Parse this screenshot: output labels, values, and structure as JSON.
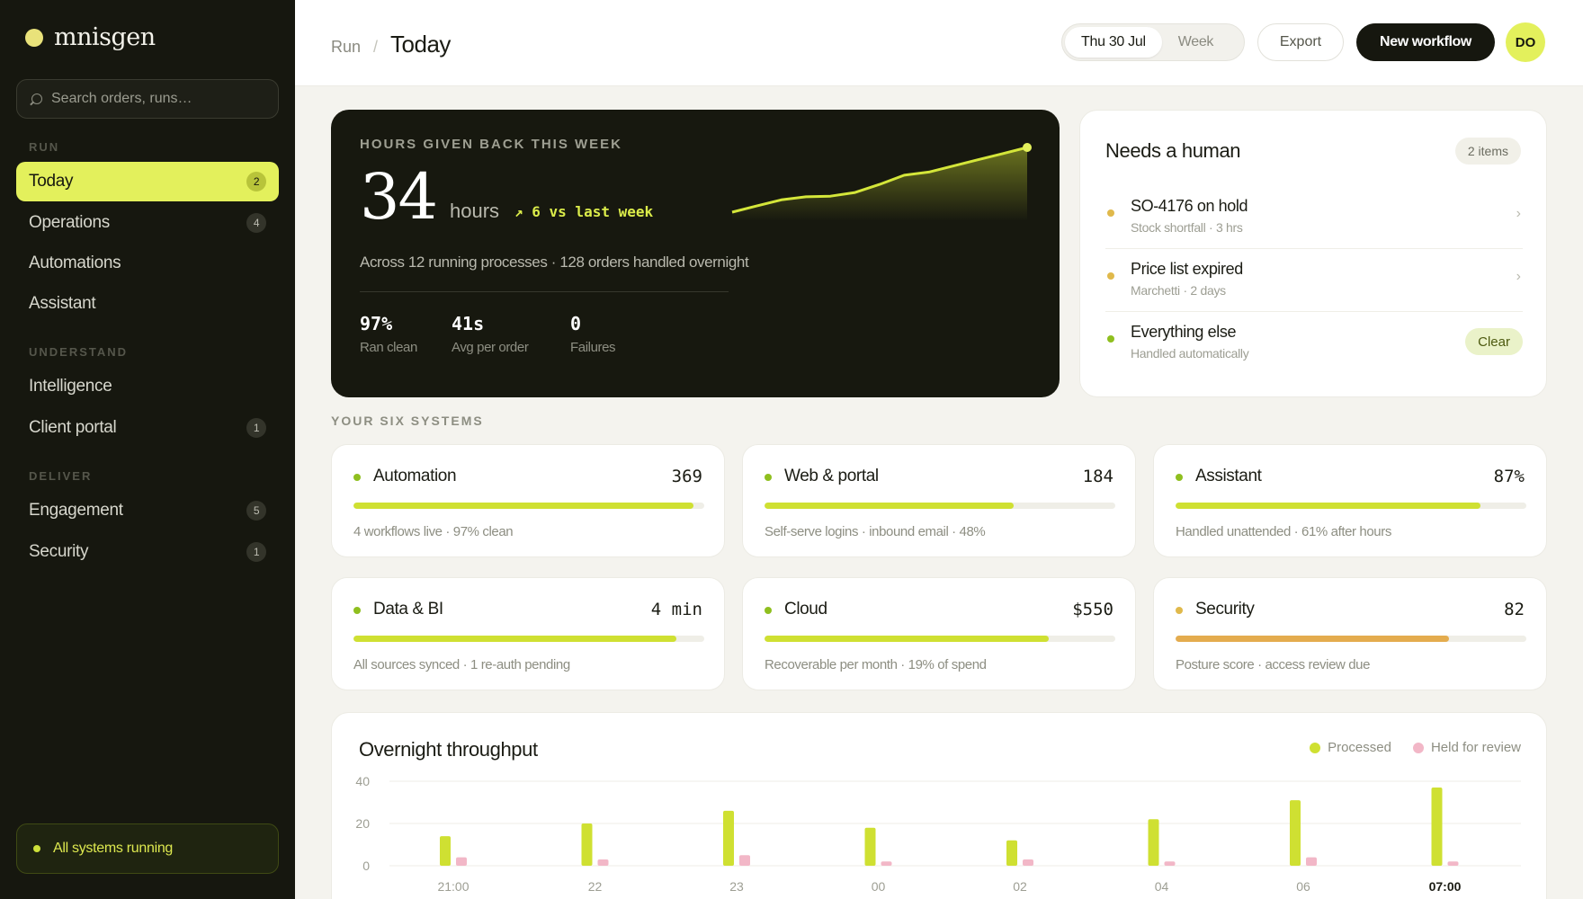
{
  "brand": {
    "name": "mnisgen"
  },
  "search": {
    "placeholder": "Search orders, runs…"
  },
  "sidebar": {
    "sections": [
      "RUN",
      "UNDERSTAND",
      "DELIVER"
    ],
    "items": [
      {
        "label": "Today",
        "badge": "2"
      },
      {
        "label": "Operations",
        "badge": "4"
      },
      {
        "label": "Automations",
        "badge": ""
      },
      {
        "label": "Assistant",
        "badge": ""
      },
      {
        "label": "Intelligence",
        "badge": ""
      },
      {
        "label": "Client portal",
        "badge": "1"
      },
      {
        "label": "Engagement",
        "badge": "5"
      },
      {
        "label": "Security",
        "badge": "1"
      }
    ],
    "status": "All systems running"
  },
  "header": {
    "breadcrumb_parent": "Run",
    "breadcrumb_sep": "/",
    "title": "Today",
    "range_day": "Thu 30 Jul",
    "range_week": "Week",
    "export_label": "Export",
    "new_label": "New workflow",
    "avatar_initials": "DO"
  },
  "hero": {
    "label": "HOURS GIVEN BACK THIS WEEK",
    "value": "34",
    "unit": "hours",
    "delta": "↗ 6 vs last week",
    "description": "Across 12 running processes · 128 orders handled overnight",
    "stats": [
      {
        "value": "97%",
        "label": "Ran clean"
      },
      {
        "value": "41s",
        "label": "Avg per order"
      },
      {
        "value": "0",
        "label": "Failures"
      }
    ],
    "trend": [
      2,
      3,
      4,
      4.5,
      4.6,
      5.2,
      6.5,
      8,
      8.5,
      9.5,
      10.5,
      11.5,
      12.5
    ]
  },
  "needs": {
    "title": "Needs a human",
    "count": "2 items",
    "rows": [
      {
        "title": "SO-4176 on hold",
        "sub": "Stock shortfall · 3 hrs",
        "action": "›",
        "color": "#e0b94b"
      },
      {
        "title": "Price list expired",
        "sub": "Marchetti · 2 days",
        "action": "›",
        "color": "#e0b94b"
      },
      {
        "title": "Everything else",
        "sub": "Handled automatically",
        "action": "Clear",
        "color": "#8fbf1f"
      }
    ]
  },
  "systems": {
    "label": "YOUR SIX SYSTEMS",
    "cards": [
      {
        "name": "Automation",
        "value": "369",
        "progress": 0.97,
        "desc": "4 workflows live · 97% clean",
        "color": "#cfe032",
        "dot": "#8fbf1f"
      },
      {
        "name": "Web & portal",
        "value": "184",
        "progress": 0.71,
        "desc": "Self-serve logins · inbound email · 48%",
        "color": "#cfe032",
        "dot": "#8fbf1f"
      },
      {
        "name": "Assistant",
        "value": "87%",
        "progress": 0.87,
        "desc": "Handled unattended · 61% after hours",
        "color": "#cfe032",
        "dot": "#8fbf1f"
      },
      {
        "name": "Data & BI",
        "value": "4 min",
        "progress": 0.92,
        "desc": "All sources synced · 1 re-auth pending",
        "color": "#cfe032",
        "dot": "#8fbf1f"
      },
      {
        "name": "Cloud",
        "value": "$550",
        "progress": 0.81,
        "desc": "Recoverable per month · 19% of spend",
        "color": "#cfe032",
        "dot": "#8fbf1f"
      },
      {
        "name": "Security",
        "value": "82",
        "progress": 0.78,
        "desc": "Posture score · access review due",
        "color": "#e4ac4e",
        "dot": "#e0b94b"
      }
    ]
  },
  "chart_data": {
    "type": "bar",
    "title": "Overnight throughput",
    "categories": [
      "21:00",
      "22",
      "23",
      "00",
      "02",
      "04",
      "06",
      "07:00"
    ],
    "series": [
      {
        "name": "Processed",
        "values": [
          14,
          20,
          26,
          18,
          12,
          22,
          31,
          37
        ],
        "color": "#cfe032"
      },
      {
        "name": "Held for review",
        "values": [
          4,
          3,
          5,
          2,
          3,
          2,
          4,
          2
        ],
        "color": "#f2b7c7"
      }
    ],
    "yticks": [
      40,
      20,
      0
    ],
    "ylim": [
      0,
      40
    ],
    "xlabel": "",
    "ylabel": "",
    "grid": true,
    "legend": "top-right"
  }
}
